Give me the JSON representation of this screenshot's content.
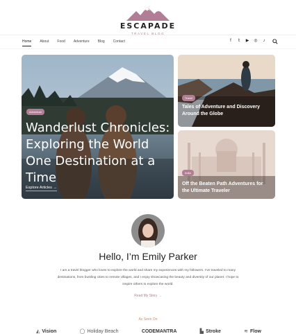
{
  "logo": {
    "name": "ESCAPADE",
    "tagline": "TRAVEL BLOG"
  },
  "nav": {
    "items": [
      "Home",
      "About",
      "Food",
      "Adventure",
      "Blog",
      "Contact"
    ],
    "active": "Home"
  },
  "social_icons": [
    "facebook-icon",
    "twitter-icon",
    "youtube-icon",
    "instagram-icon",
    "tiktok-icon"
  ],
  "hero": {
    "category": "Adventure",
    "title": "Wanderlust Chronicles: Exploring the World One Destination at a Time",
    "link": "Explore Articles →"
  },
  "cards": [
    {
      "category": "Travel",
      "title": "Tales of Adventure and Discovery Around the Globe"
    },
    {
      "category": "India",
      "title": "Off the Beaten Path Adventures for the Ultimate Traveler"
    }
  ],
  "about": {
    "heading": "Hello, I’m Emily Parker",
    "bio": "I am a travel blogger who loves to explore the world and share my experiences with my followers. I’ve traveled to many destinations, from bustling cities to remote villages, and I enjoy showcasing the beauty and diversity of our planet. I hope to inspire others to explore the world.",
    "link": "Read My Story →"
  },
  "seen_on": {
    "label": "As Seen On",
    "brands": [
      "Vision",
      "Holiday Beach",
      "CODEMANTRA",
      "Stroke",
      "Flow"
    ]
  },
  "colors": {
    "accent": "#b27e95",
    "seen_label": "#c98a6c"
  }
}
